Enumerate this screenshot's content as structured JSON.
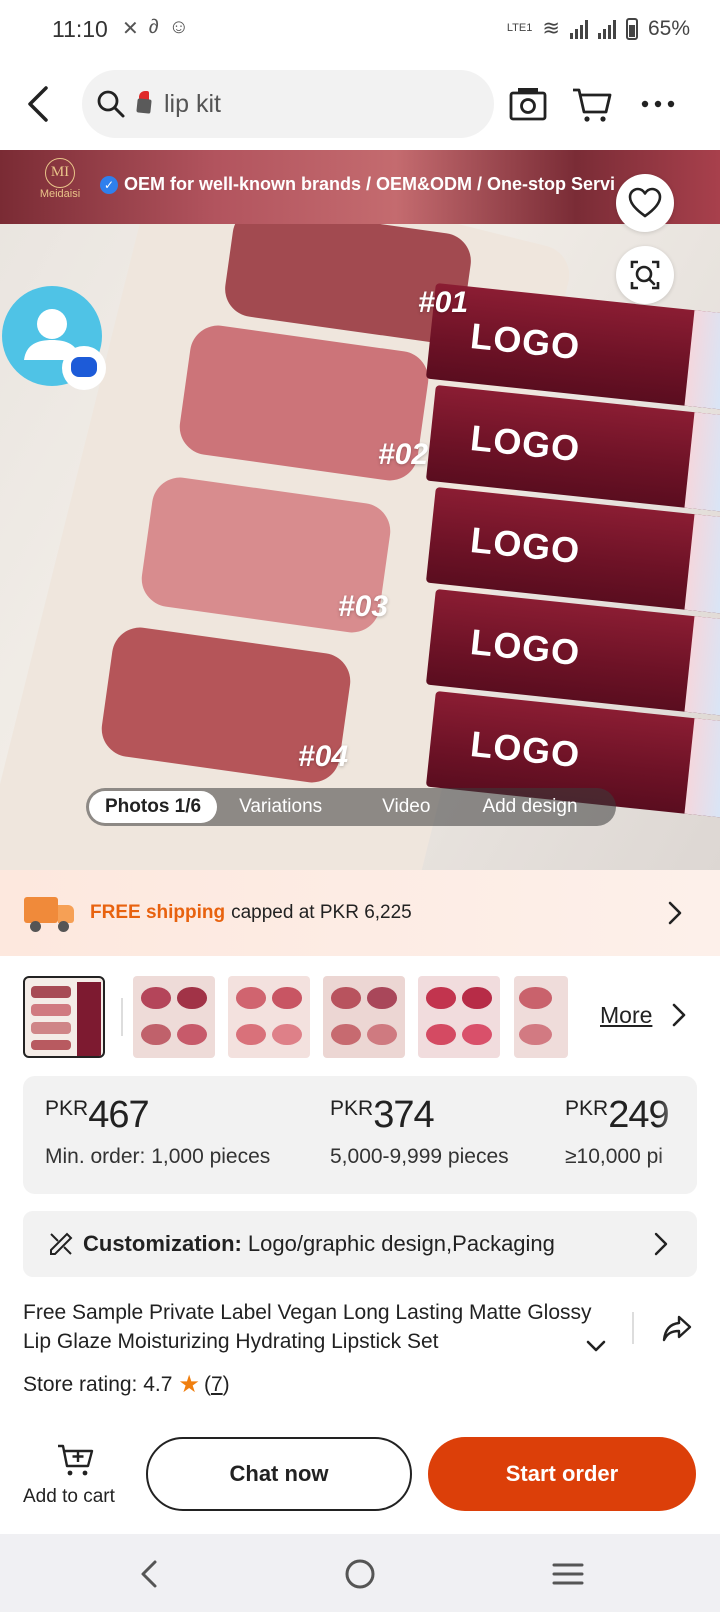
{
  "status_bar": {
    "time": "11:10",
    "battery": "65%",
    "network_label": "LTE1"
  },
  "search": {
    "query": "lip kit"
  },
  "product_image": {
    "banner_text": "OEM for well-known brands / OEM&ODM / One-stop Servi",
    "brand_name": "Meidaisi",
    "brand_initials": "MI",
    "shade_labels": [
      "#01",
      "#02",
      "#03",
      "#04"
    ],
    "tube_logo_text": "LOGO",
    "media_tabs": [
      "Photos 1/6",
      "Variations",
      "Video",
      "Add design"
    ]
  },
  "shipping": {
    "highlight": "FREE shipping",
    "text": "capped at PKR 6,225"
  },
  "thumbnails": {
    "more_label": "More"
  },
  "price_tiers": [
    {
      "currency": "PKR",
      "amount": "467",
      "quantity": "Min. order: 1,000 pieces"
    },
    {
      "currency": "PKR",
      "amount": "374",
      "quantity": "5,000-9,999 pieces"
    },
    {
      "currency": "PKR",
      "amount": "249",
      "quantity": "≥10,000 pi"
    }
  ],
  "customization": {
    "label": "Customization:",
    "value": "Logo/graphic design,Packaging"
  },
  "product": {
    "title": "Free Sample Private Label Vegan Long Lasting Matte Glossy Lip Glaze Moisturizing Hydrating Lipstick Set",
    "rating_label": "Store rating: 4.7",
    "rating_count": "7"
  },
  "actions": {
    "add_to_cart": "Add to cart",
    "chat": "Chat now",
    "order": "Start order"
  },
  "colors": {
    "accent": "#dc3f09",
    "shipping_highlight": "#e8620f",
    "rating_star": "#f07f0f"
  }
}
